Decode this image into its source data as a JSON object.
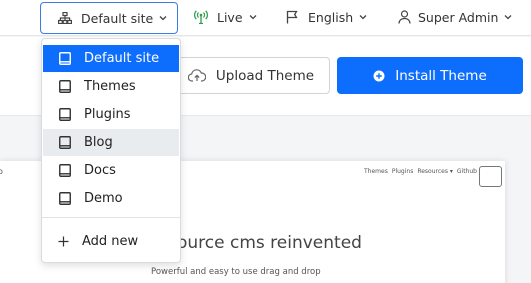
{
  "topbar": {
    "site_selector": "Default site",
    "live": "Live",
    "language": "English",
    "user": "Super Admin"
  },
  "toolbar": {
    "upload_label": "Upload Theme",
    "install_label": "Install Theme"
  },
  "dropdown": {
    "items": [
      {
        "label": "Default site",
        "icon": "site-icon"
      },
      {
        "label": "Themes",
        "icon": "site-icon"
      },
      {
        "label": "Plugins",
        "icon": "site-icon"
      },
      {
        "label": "Blog",
        "icon": "site-icon"
      },
      {
        "label": "Docs",
        "icon": "site-icon"
      },
      {
        "label": "Demo",
        "icon": "site-icon"
      }
    ],
    "active_index": 0,
    "hover_index": 3,
    "add_new": "Add new"
  },
  "preview": {
    "edge_glyph": "o",
    "nav": [
      "Themes",
      "Plugins",
      "Resources ▾",
      "Github"
    ],
    "heading": "ource cms reinvented",
    "subheading": "Powerful and easy to use drag and drop"
  },
  "colors": {
    "accent": "#0d6efd",
    "selector_border": "#3a7be8",
    "hover_bg": "#e9ecef",
    "live_icon": "#2e9d4a"
  }
}
